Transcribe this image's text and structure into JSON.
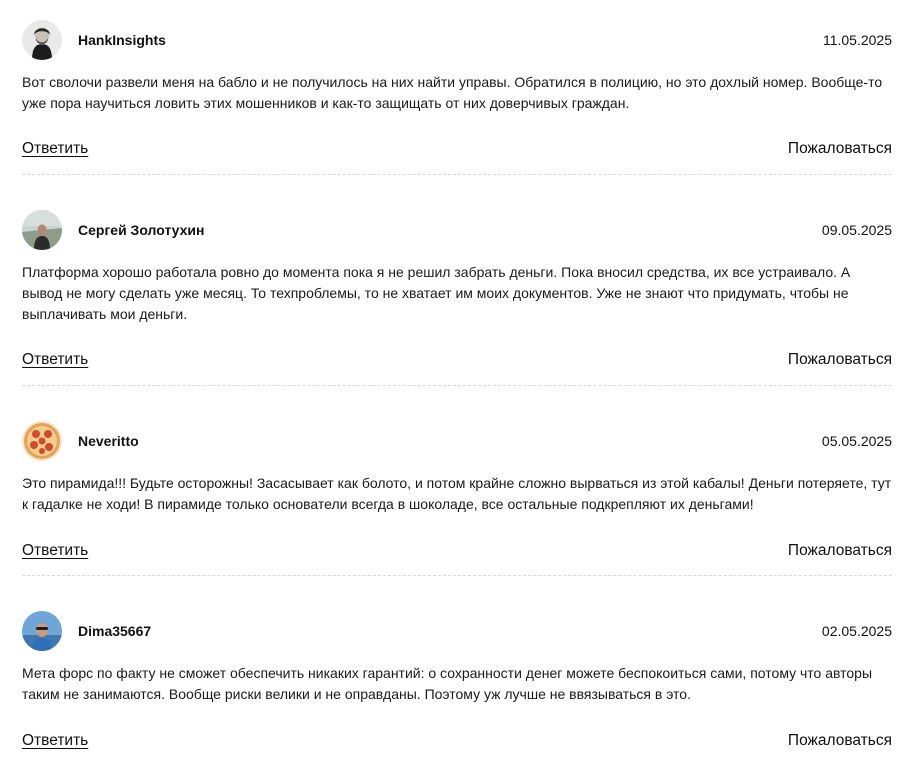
{
  "comments": [
    {
      "author": "HankInsights",
      "date": "11.05.2025",
      "avatar_icon": "person-avatar-icon",
      "text": "Вот сволочи развели меня на бабло и не получилось на них найти управы. Обратился в полицию, но это дохлый номер. Вообще-то уже пора научиться ловить этих мошенников и как-то защищать от них доверчивых граждан.",
      "reply_label": "Ответить",
      "report_label": "Пожаловаться"
    },
    {
      "author": "Сергей Золотухин",
      "date": "09.05.2025",
      "avatar_icon": "person-avatar-icon",
      "text": "Платформа хорошо работала ровно до момента пока я не решил забрать деньги. Пока вносил средства, их все устраивало. А вывод не могу сделать уже месяц. То техпроблемы, то не хватает им моих документов. Уже не знают что придумать, чтобы не выплачивать мои деньги.",
      "reply_label": "Ответить",
      "report_label": "Пожаловаться"
    },
    {
      "author": "Neveritto",
      "date": "05.05.2025",
      "avatar_icon": "pizza-avatar-icon",
      "text": "Это пирамида!!! Будьте осторожны! Засасывает как болото, и потом крайне сложно вырваться из этой кабалы! Деньги потеряете, тут к гадалке не ходи! В пирамиде только основатели всегда в шоколаде, все остальные подкрепляют их деньгами!",
      "reply_label": "Ответить",
      "report_label": "Пожаловаться"
    },
    {
      "author": "Dima35667",
      "date": "02.05.2025",
      "avatar_icon": "person-avatar-icon",
      "text": "Мета форс по факту не сможет обеспечить никаких гарантий: о сохранности денег можете беспокоиться сами, потому что авторы таким не занимаются. Вообще риски велики и не оправданы. Поэтому уж лучше не ввязываться в это.",
      "reply_label": "Ответить",
      "report_label": "Пожаловаться"
    }
  ]
}
